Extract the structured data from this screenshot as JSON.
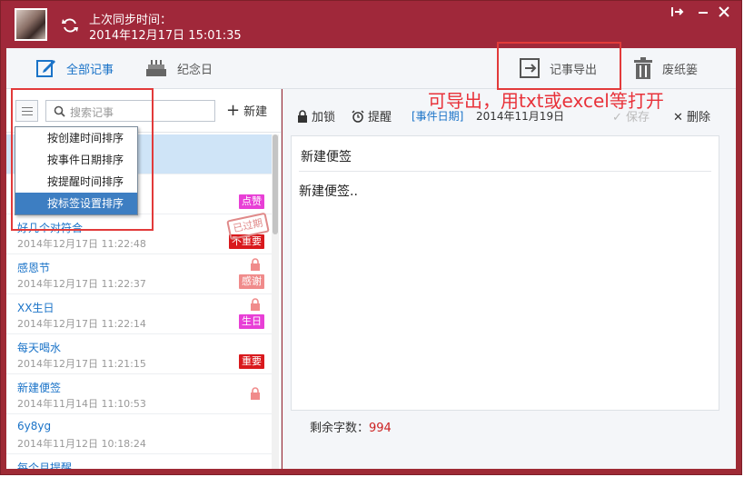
{
  "titlebar": {
    "sync_label": "上次同步时间：",
    "sync_time": "2014年12月17日 15:01:35"
  },
  "toolbar": {
    "all_notes": "全部记事",
    "anniversary": "纪念日",
    "export": "记事导出",
    "trash": "废纸篓"
  },
  "list": {
    "search_placeholder": "搜索记事",
    "new_label": "新建",
    "sort_menu": [
      "按创建时间排序",
      "按事件日期排序",
      "按提醒时间排序",
      "按标签设置排序"
    ],
    "expired_stamp": "已过期",
    "items": [
      {
        "title": "",
        "date": "",
        "tag": ""
      },
      {
        "title": "",
        "date": "",
        "tag": "点赞",
        "tag_color": "#e83fd6"
      },
      {
        "title": "好几个对符合",
        "date": "2014年12月17日 11:22:48",
        "tag": "不重要",
        "tag_color": "#d9191d"
      },
      {
        "title": "感恩节",
        "date": "2014年12月17日 11:22:37",
        "tag": "感谢",
        "tag_color": "#f08b8b"
      },
      {
        "title": "XX生日",
        "date": "2014年12月17日 11:22:14",
        "tag": "生日",
        "tag_color": "#e83fd6"
      },
      {
        "title": "每天喝水",
        "date": "2014年12月17日 11:21:15",
        "tag": "重要",
        "tag_color": "#d9191d"
      },
      {
        "title": "新建便签",
        "date": "2014年11月14日 11:10:53",
        "tag": ""
      },
      {
        "title": "6y8yg",
        "date": "2014年11月12日 10:18:24",
        "tag": ""
      },
      {
        "title": "每个月提醒",
        "date": "",
        "tag": ""
      }
    ]
  },
  "editor": {
    "lock": "加锁",
    "remind": "提醒",
    "event_date_label": "[事件日期]",
    "event_date": "2014年11月19日",
    "save": "保存",
    "delete": "删除",
    "note_title": "新建便签",
    "note_body": "新建便签..",
    "counter_label": "剩余字数：",
    "counter_value": "994"
  },
  "annotation": "可导出，用txt或excel等打开"
}
